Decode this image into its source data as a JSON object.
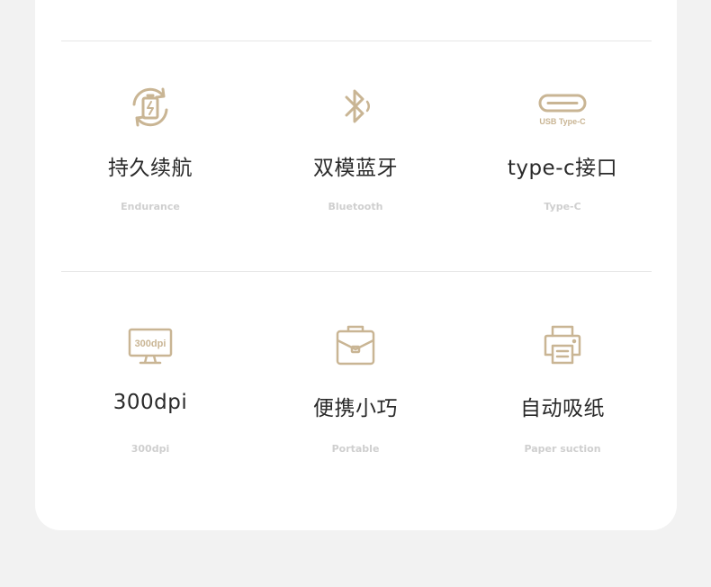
{
  "accent_color": "#c9b594",
  "features": [
    {
      "icon": "battery-cycle-icon",
      "title": "持久续航",
      "subtitle": "Endurance"
    },
    {
      "icon": "bluetooth-icon",
      "title": "双模蓝牙",
      "subtitle": "Bluetooth"
    },
    {
      "icon": "usb-type-c-icon",
      "icon_text": "USB Type-C",
      "title": "type-c接口",
      "subtitle": "Type-C"
    },
    {
      "icon": "monitor-300dpi-icon",
      "icon_text": "300dpi",
      "title": "300dpi",
      "subtitle": "300dpi"
    },
    {
      "icon": "briefcase-icon",
      "title": "便携小巧",
      "subtitle": "Portable"
    },
    {
      "icon": "printer-icon",
      "title": "自动吸纸",
      "subtitle": "Paper suction"
    }
  ]
}
